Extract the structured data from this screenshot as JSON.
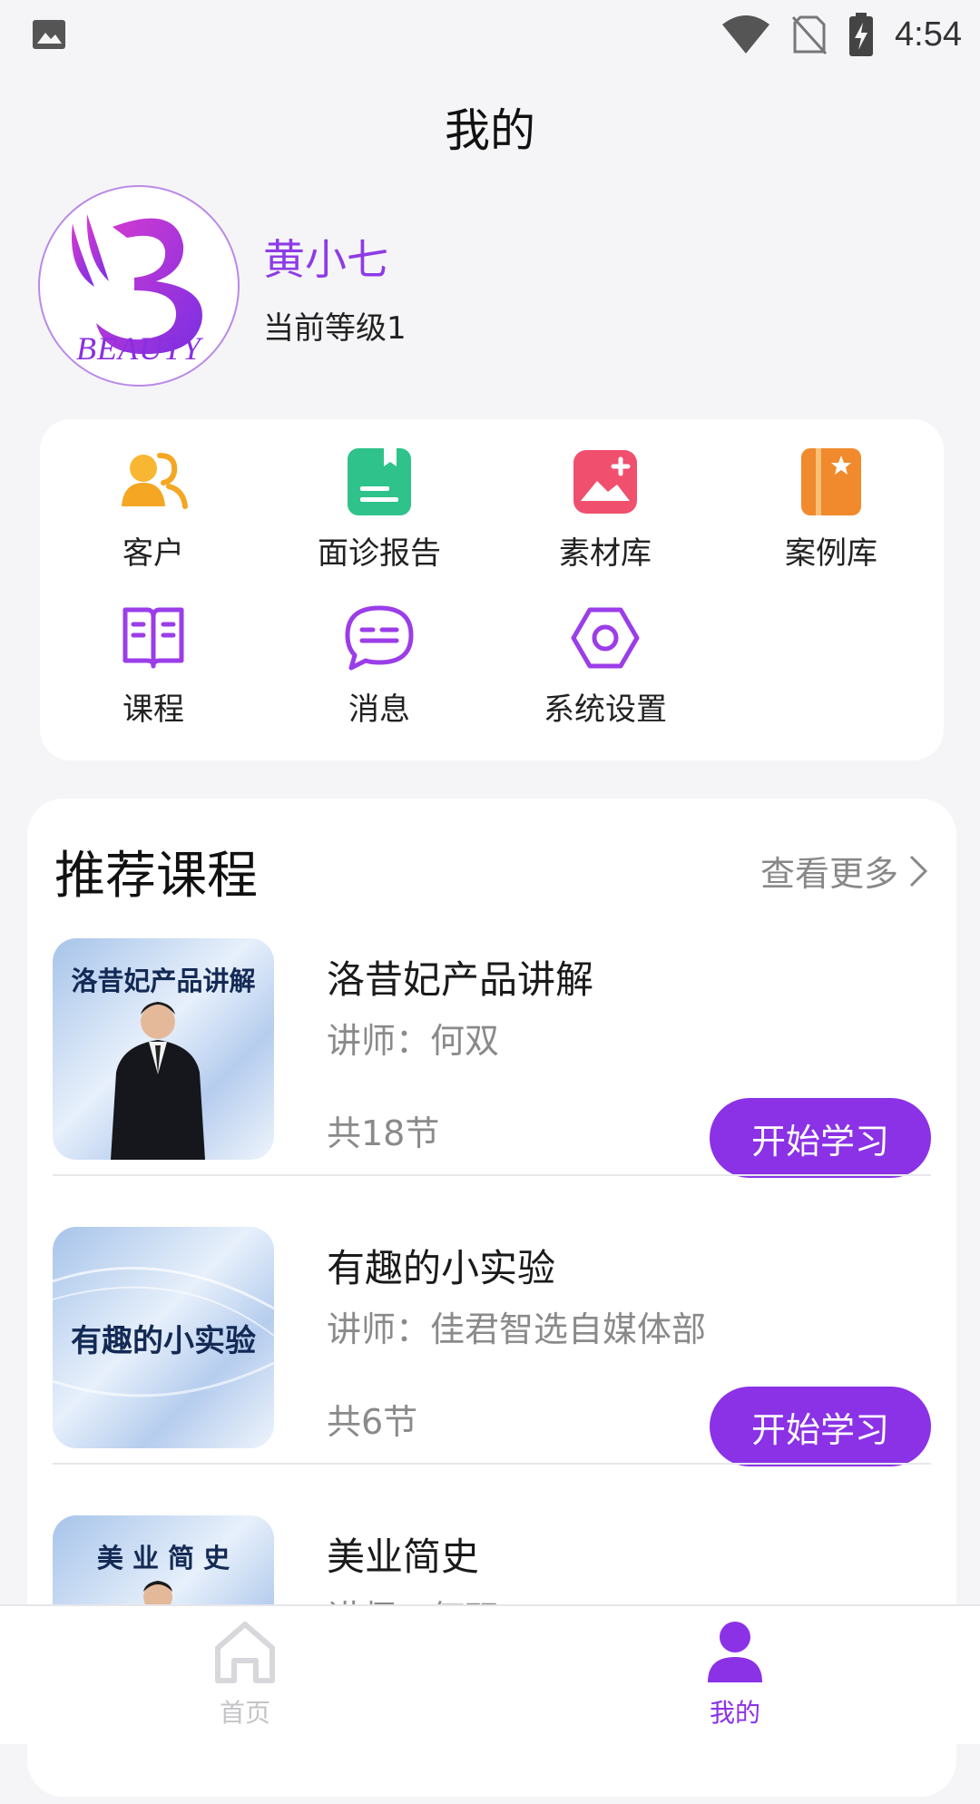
{
  "status_bar": {
    "time": "4:54",
    "icons": [
      "image-icon",
      "wifi-icon",
      "no-sim-icon",
      "battery-charging-icon"
    ]
  },
  "header": {
    "title": "我的"
  },
  "profile": {
    "avatar_brand": "BEAUTY",
    "name": "黄小七",
    "level": "当前等级1"
  },
  "menu": {
    "items": [
      {
        "label": "客户",
        "icon": "customers-icon",
        "color": "#f5a623"
      },
      {
        "label": "面诊报告",
        "icon": "report-icon",
        "color": "#2fc28b"
      },
      {
        "label": "素材库",
        "icon": "gallery-icon",
        "color": "#f0506e"
      },
      {
        "label": "案例库",
        "icon": "case-book-icon",
        "color": "#f08a2c"
      },
      {
        "label": "课程",
        "icon": "book-icon",
        "color": "#9b3de8"
      },
      {
        "label": "消息",
        "icon": "message-icon",
        "color": "#9b3de8"
      },
      {
        "label": "系统设置",
        "icon": "settings-icon",
        "color": "#9b3de8"
      }
    ]
  },
  "recommended": {
    "title": "推荐课程",
    "more_label": "查看更多",
    "courses": [
      {
        "thumb_text": "洛昔妃产品讲解",
        "title": "洛昔妃产品讲解",
        "teacher": "讲师：何双",
        "count": "共18节",
        "button": "开始学习"
      },
      {
        "thumb_text": "有趣的小实验",
        "title": "有趣的小实验",
        "teacher": "讲师：佳君智选自媒体部",
        "count": "共6节",
        "button": "开始学习"
      },
      {
        "thumb_text": "美 业 简 史",
        "title": "美业简史",
        "teacher": "讲师：何双",
        "count": "",
        "button": ""
      }
    ]
  },
  "bottom_nav": {
    "items": [
      {
        "label": "首页",
        "icon": "home-icon",
        "active": false
      },
      {
        "label": "我的",
        "icon": "person-icon",
        "active": true
      }
    ]
  },
  "colors": {
    "accent": "#8b31e6",
    "background": "#f5f5f7",
    "card": "#ffffff"
  }
}
